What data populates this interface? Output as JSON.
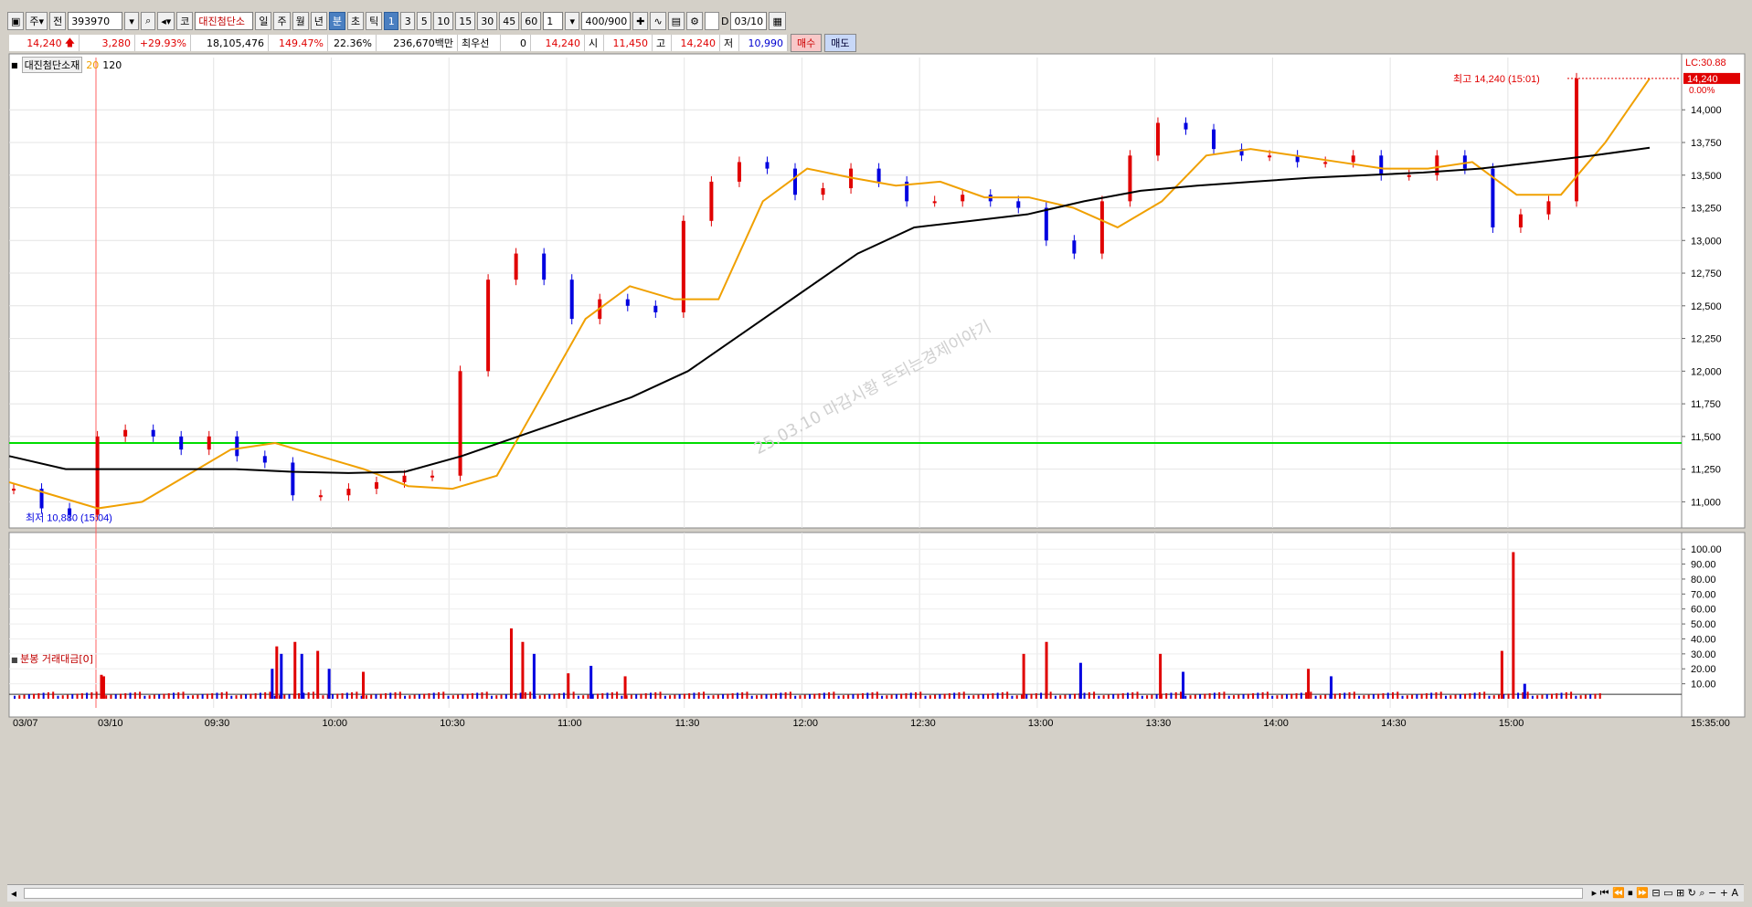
{
  "toolbar": {
    "market": "주",
    "type": "전",
    "code": "393970",
    "name_prefix": "코",
    "name": "대진첨단소",
    "periods": [
      "일",
      "주",
      "월",
      "년",
      "분",
      "초",
      "틱"
    ],
    "active_period": "분",
    "intervals": [
      "1",
      "3",
      "5",
      "10",
      "15",
      "30",
      "45",
      "60"
    ],
    "active_interval": "1",
    "multiplier": "1",
    "count": "400/900",
    "d_label": "D",
    "date": "03/10"
  },
  "quote": {
    "price": "14,240",
    "change": "3,280",
    "change_pct": "+29.93%",
    "volume": "18,105,476",
    "vol_ratio": "149.47%",
    "turnover": "22.36%",
    "amount": "236,670백만",
    "best_label": "최우선",
    "best_value": "0",
    "best_price": "14,240",
    "open_label": "시",
    "open": "11,450",
    "high_label": "고",
    "high": "14,240",
    "low_label": "저",
    "low": "10,990",
    "buy": "매수",
    "sell": "매도"
  },
  "legend": {
    "name": "대진첨단소재",
    "ma1": "20",
    "ma2": "120",
    "volume_title": "분봉 거래대금[0]"
  },
  "watermark": "25.03.10 마감시황 돈되는경제이야기",
  "colors": {
    "up": "#e00000",
    "down": "#0000e0",
    "ma20": "#f0a000",
    "ma120": "#000000",
    "hline": "#00dd00"
  },
  "chart_data": [
    {
      "type": "line",
      "title": "대진첨단소재",
      "y_ticks": [
        11000,
        11250,
        11500,
        11750,
        12000,
        12250,
        12500,
        12750,
        13000,
        13250,
        13500,
        13750,
        14000
      ],
      "ylim": [
        10800,
        14400
      ],
      "x_ticks": [
        "03/07",
        "03/10",
        "09:30",
        "10:00",
        "10:30",
        "11:00",
        "11:30",
        "12:00",
        "12:30",
        "13:00",
        "13:30",
        "14:00",
        "14:30",
        "15:00"
      ],
      "right_top_label": "LC:30.88",
      "last_price_label": "14,240",
      "last_pct_label": "0.00%",
      "high_annotation": "최고 14,240 (15:01)",
      "low_annotation": "최저 10,880 (15:04)",
      "hline": 11450,
      "series": [
        {
          "name": "20",
          "values": [
            11150,
            11050,
            10950,
            11000,
            11200,
            11400,
            11450,
            11350,
            11250,
            11120,
            11100,
            11200,
            11800,
            12400,
            12650,
            12550,
            12550,
            13300,
            13550,
            13480,
            13420,
            13450,
            13330,
            13330,
            13250,
            13100,
            13300,
            13650,
            13700,
            13650,
            13600,
            13550,
            13550,
            13600,
            13350,
            13350,
            13750,
            14240
          ]
        },
        {
          "name": "120",
          "values": [
            11350,
            11250,
            11250,
            11250,
            11250,
            11230,
            11220,
            11230,
            11350,
            11500,
            11650,
            11800,
            12000,
            12300,
            12600,
            12900,
            13100,
            13150,
            13200,
            13300,
            13380,
            13420,
            13450,
            13480,
            13500,
            13520,
            13550,
            13600,
            13650,
            13710
          ]
        }
      ],
      "price_points": [
        11100,
        10950,
        10900,
        11500,
        11550,
        11500,
        11400,
        11500,
        11350,
        11300,
        11050,
        11050,
        11100,
        11150,
        11200,
        11200,
        12000,
        12700,
        12900,
        12700,
        12400,
        12550,
        12500,
        12450,
        13150,
        13450,
        13600,
        13550,
        13350,
        13400,
        13550,
        13450,
        13300,
        13300,
        13350,
        13300,
        13250,
        13000,
        12900,
        13300,
        13650,
        13900,
        13850,
        13700,
        13650,
        13650,
        13600,
        13600,
        13650,
        13500,
        13500,
        13650,
        13550,
        13100,
        13200,
        13300,
        14240
      ]
    },
    {
      "type": "bar",
      "title": "분봉 거래대금[0]",
      "y_ticks": [
        10,
        20,
        30,
        40,
        50,
        60,
        70,
        80,
        90,
        100
      ],
      "y_tick_labels": [
        "10.00",
        "20.00",
        "30.00",
        "40.00",
        "50.00",
        "60.00",
        "70.00",
        "80.00",
        "90.00",
        "100.00"
      ],
      "ylim": [
        0,
        105
      ],
      "time_label": "15:35:00",
      "bars": [
        {
          "x": 0.05,
          "v": 16,
          "up": true
        },
        {
          "x": 0.06,
          "v": 15,
          "up": true
        },
        {
          "x": 0.8,
          "v": 20,
          "up": false
        },
        {
          "x": 0.82,
          "v": 35,
          "up": true
        },
        {
          "x": 0.84,
          "v": 30,
          "up": false
        },
        {
          "x": 0.9,
          "v": 38,
          "up": true
        },
        {
          "x": 0.93,
          "v": 30,
          "up": false
        },
        {
          "x": 1.0,
          "v": 32,
          "up": true
        },
        {
          "x": 1.05,
          "v": 20,
          "up": false
        },
        {
          "x": 1.2,
          "v": 18,
          "up": true
        },
        {
          "x": 1.85,
          "v": 47,
          "up": true
        },
        {
          "x": 1.9,
          "v": 38,
          "up": true
        },
        {
          "x": 1.95,
          "v": 30,
          "up": false
        },
        {
          "x": 2.1,
          "v": 17,
          "up": true
        },
        {
          "x": 2.2,
          "v": 22,
          "up": false
        },
        {
          "x": 2.35,
          "v": 15,
          "up": true
        },
        {
          "x": 4.1,
          "v": 30,
          "up": true
        },
        {
          "x": 4.2,
          "v": 38,
          "up": true
        },
        {
          "x": 4.35,
          "v": 24,
          "up": false
        },
        {
          "x": 4.7,
          "v": 30,
          "up": true
        },
        {
          "x": 4.8,
          "v": 18,
          "up": false
        },
        {
          "x": 5.35,
          "v": 20,
          "up": true
        },
        {
          "x": 5.45,
          "v": 15,
          "up": false
        },
        {
          "x": 6.2,
          "v": 32,
          "up": true
        },
        {
          "x": 6.25,
          "v": 98,
          "up": true
        },
        {
          "x": 6.3,
          "v": 10,
          "up": false
        }
      ]
    }
  ]
}
